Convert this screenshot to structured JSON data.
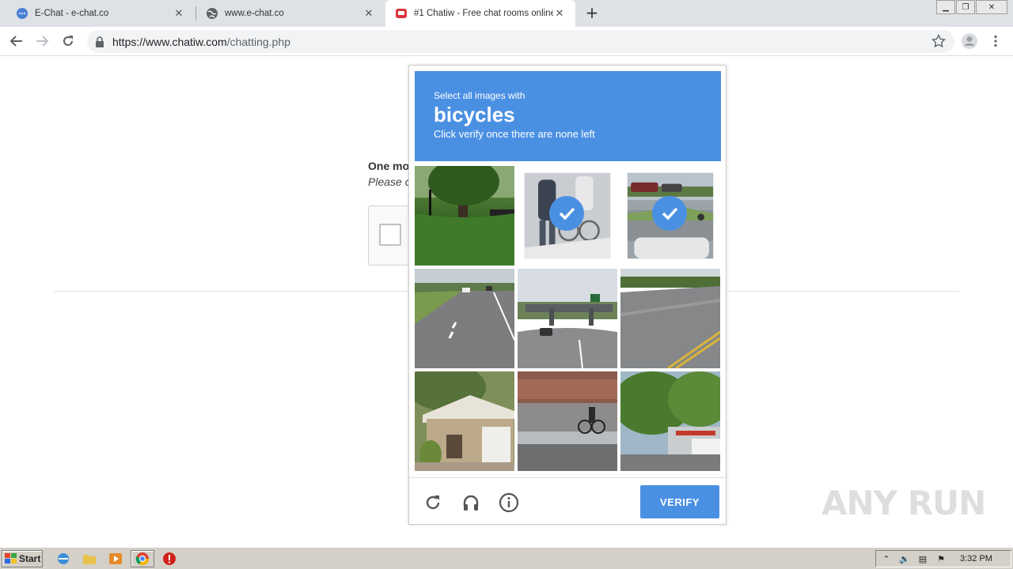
{
  "browser": {
    "tabs": [
      {
        "title": "E-Chat - e-chat.co",
        "icon": "chat-bubble-icon"
      },
      {
        "title": "www.e-chat.co",
        "icon": "globe-icon"
      },
      {
        "title": "#1 Chatiw - Free chat rooms online",
        "icon": "chatiw-icon"
      }
    ],
    "new_tab_label": "+",
    "url_host": "https://www.chatiw.com",
    "url_path": "/chatting.php"
  },
  "page": {
    "heading_fragment": "One mo",
    "subtext_fragment": "Please c"
  },
  "challenge": {
    "instruction_pre": "Select all images with",
    "target": "bicycles",
    "instruction_post": "Click verify once there are none left",
    "tiles": [
      {
        "desc": "grass-tree-car",
        "selected": false
      },
      {
        "desc": "pedestrian-cyclist",
        "selected": true
      },
      {
        "desc": "street-cyclist-car",
        "selected": true
      },
      {
        "desc": "highway-road",
        "selected": false
      },
      {
        "desc": "overpass-road",
        "selected": false
      },
      {
        "desc": "highway-yellow-line",
        "selected": false
      },
      {
        "desc": "house",
        "selected": false
      },
      {
        "desc": "cyclist-guardrail",
        "selected": false
      },
      {
        "desc": "trees-truck",
        "selected": false
      }
    ],
    "verify_label": "VERIFY",
    "accent": "#4a90e2"
  },
  "watermark": "ANY RUN",
  "taskbar": {
    "start_label": "Start",
    "clock": "3:32 PM"
  }
}
